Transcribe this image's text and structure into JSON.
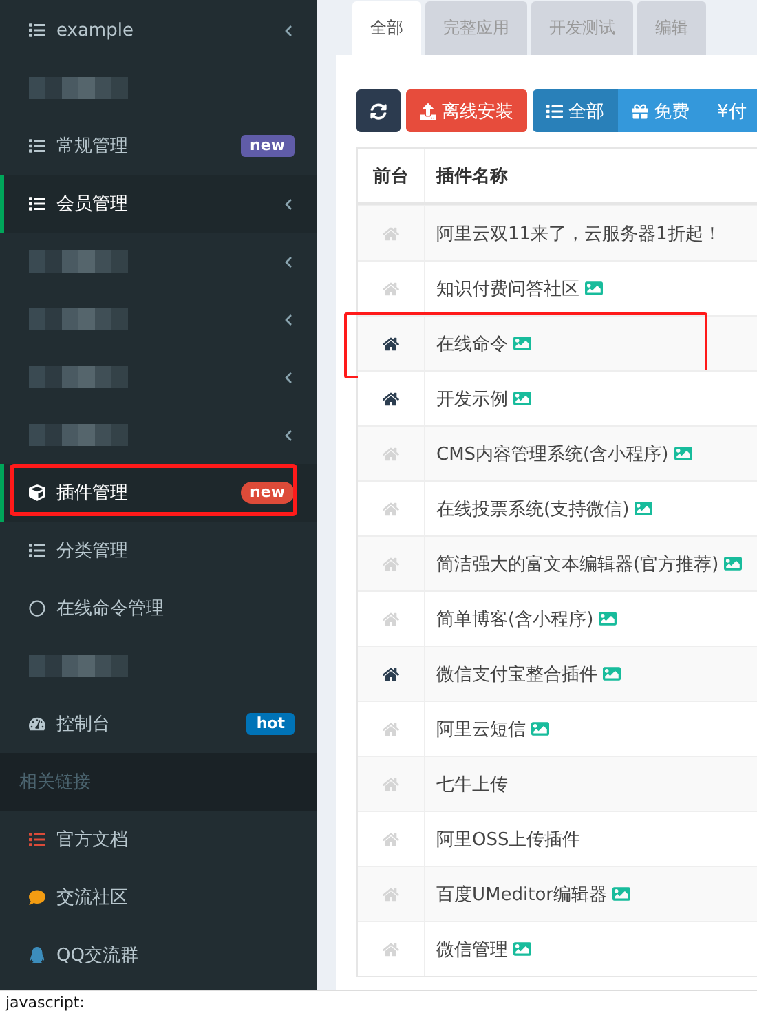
{
  "sidebar": {
    "items": [
      {
        "kind": "link",
        "label": "example",
        "has_submenu": true,
        "active": false,
        "highlighted": false
      },
      {
        "kind": "redacted",
        "has_submenu": false
      },
      {
        "kind": "link",
        "label": "常规管理",
        "badge": {
          "text": "new",
          "color": "#605ca8"
        },
        "has_submenu": false,
        "active": false,
        "highlighted": false
      },
      {
        "kind": "link",
        "label": "会员管理",
        "has_submenu": true,
        "active": true,
        "highlighted": false
      },
      {
        "kind": "redacted",
        "has_submenu": true
      },
      {
        "kind": "redacted",
        "has_submenu": true
      },
      {
        "kind": "redacted",
        "has_submenu": true
      },
      {
        "kind": "redacted",
        "has_submenu": true
      },
      {
        "kind": "link",
        "label": "插件管理",
        "badge": {
          "text": "new",
          "color": "#dd4b39"
        },
        "has_submenu": false,
        "active": true,
        "highlighted": true
      },
      {
        "kind": "link",
        "label": "分类管理",
        "has_submenu": false,
        "active": false,
        "highlighted": false
      },
      {
        "kind": "link",
        "label": "在线命令管理",
        "has_submenu": false,
        "active": false,
        "highlighted": false
      },
      {
        "kind": "redacted",
        "has_submenu": false
      },
      {
        "kind": "link",
        "label": "控制台",
        "badge": {
          "text": "hot",
          "color": "#0073b7"
        },
        "has_submenu": false,
        "active": false,
        "highlighted": false
      },
      {
        "kind": "header",
        "label": "相关链接"
      },
      {
        "kind": "link",
        "label": "官方文档",
        "has_submenu": false,
        "active": false,
        "highlighted": false
      },
      {
        "kind": "link",
        "label": "交流社区",
        "has_submenu": false,
        "active": false,
        "highlighted": false
      },
      {
        "kind": "link",
        "label": "QQ交流群",
        "has_submenu": false,
        "active": false,
        "highlighted": false
      }
    ]
  },
  "tabs": [
    {
      "label": "全部",
      "selected": true
    },
    {
      "label": "完整应用",
      "selected": false
    },
    {
      "label": "开发测试",
      "selected": false
    },
    {
      "label": "编辑",
      "selected": false
    }
  ],
  "toolbar": [
    {
      "kind": "refresh"
    },
    {
      "kind": "upload",
      "label": "离线安装"
    },
    {
      "kind": "list",
      "label": "全部",
      "selected": true
    },
    {
      "kind": "gift",
      "label": "免费",
      "selected": false
    },
    {
      "kind": "yen",
      "label": "¥付",
      "selected": false
    }
  ],
  "table": {
    "columns": [
      "前台",
      "插件名称"
    ],
    "rows": [
      {
        "frontend": false,
        "name": "阿里云双11来了，云服务器1折起！",
        "has_image": false,
        "highlighted": false
      },
      {
        "frontend": false,
        "name": "知识付费问答社区",
        "has_image": true,
        "highlighted": false
      },
      {
        "frontend": true,
        "name": "在线命令",
        "has_image": true,
        "highlighted": true
      },
      {
        "frontend": true,
        "name": "开发示例",
        "has_image": true,
        "highlighted": false
      },
      {
        "frontend": false,
        "name": "CMS内容管理系统(含小程序)",
        "has_image": true,
        "highlighted": false
      },
      {
        "frontend": false,
        "name": "在线投票系统(支持微信)",
        "has_image": true,
        "highlighted": false
      },
      {
        "frontend": false,
        "name": "简洁强大的富文本编辑器(官方推荐)",
        "has_image": true,
        "highlighted": false
      },
      {
        "frontend": false,
        "name": "简单博客(含小程序)",
        "has_image": true,
        "highlighted": false
      },
      {
        "frontend": true,
        "name": "微信支付宝整合插件",
        "has_image": true,
        "highlighted": false
      },
      {
        "frontend": false,
        "name": "阿里云短信",
        "has_image": true,
        "highlighted": false
      },
      {
        "frontend": false,
        "name": "七牛上传",
        "has_image": false,
        "highlighted": false
      },
      {
        "frontend": false,
        "name": "阿里OSS上传插件",
        "has_image": false,
        "highlighted": false
      },
      {
        "frontend": false,
        "name": "百度UMeditor编辑器",
        "has_image": true,
        "highlighted": false
      },
      {
        "frontend": false,
        "name": "微信管理",
        "has_image": true,
        "highlighted": false
      }
    ]
  },
  "status_bar": "javascript:"
}
